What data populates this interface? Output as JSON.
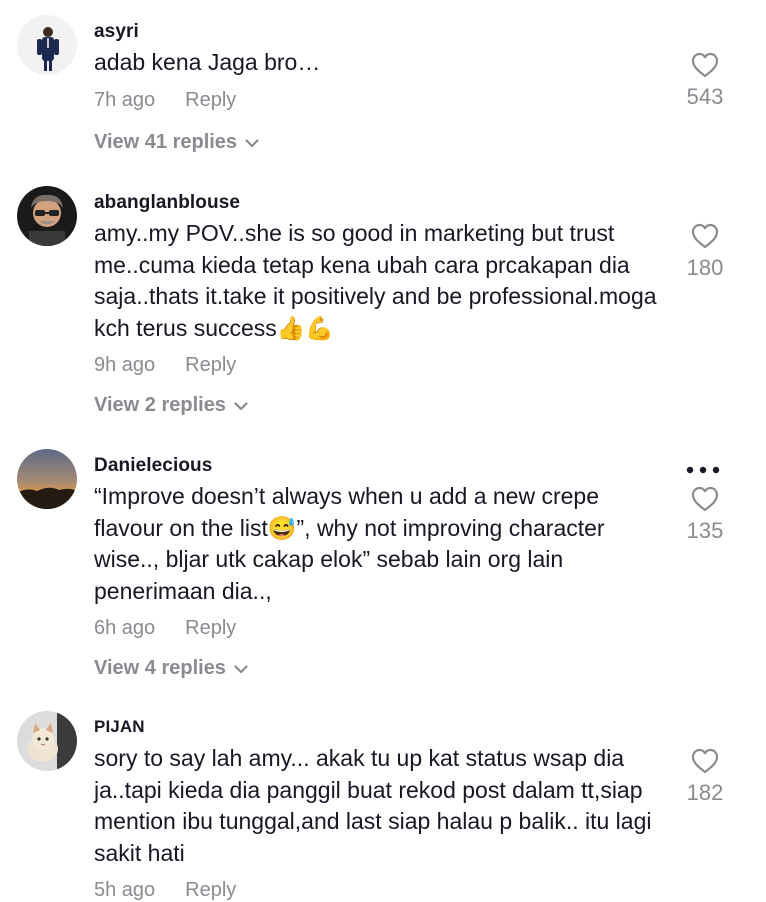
{
  "comments": [
    {
      "username": "asyri",
      "text": "adab kena Jaga bro…",
      "time": "7h ago",
      "reply": "Reply",
      "view_replies": "View 41 replies",
      "likes": "543"
    },
    {
      "username": "abanglanblouse",
      "text": "amy..my POV..she is so good in marketing but trust me..cuma kieda tetap kena ubah cara prcakapan dia saja..thats it.take it positively and be professional.moga kch terus success👍💪",
      "time": "9h ago",
      "reply": "Reply",
      "view_replies": "View 2 replies",
      "likes": "180"
    },
    {
      "username": "Danielecious",
      "text": "“Improve doesn’t always when u add a new crepe flavour on the list😅”, why not improving character wise.., bljar utk cakap elok” sebab lain org lain penerimaan dia..,",
      "time": "6h ago",
      "reply": "Reply",
      "view_replies": "View 4 replies",
      "likes": "135"
    },
    {
      "username": "PIJAN",
      "text": "sory to say lah amy... akak tu up kat status wsap dia ja..tapi kieda dia panggil buat rekod post dalam tt,siap mention ibu tunggal,and last siap halau p balik.. itu lagi sakit hati",
      "time": "5h ago",
      "reply": "Reply",
      "likes": "182"
    }
  ],
  "colors": {
    "primary_text": "#161823",
    "secondary_text": "#8a8b91"
  },
  "icons": {
    "like": "heart-outline-icon",
    "expand": "chevron-down-icon",
    "more": "more-dots-icon"
  }
}
